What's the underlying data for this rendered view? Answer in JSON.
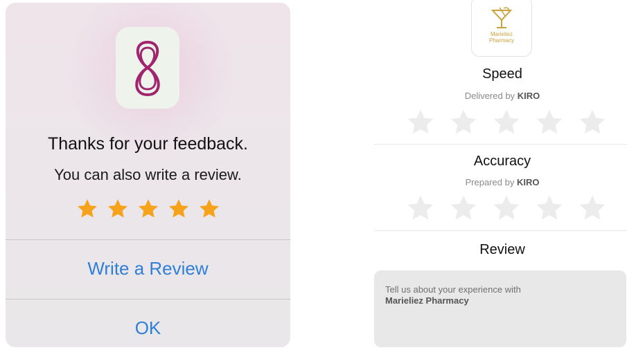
{
  "review_alert": {
    "title": "Thanks for your feedback.",
    "message": "You can also write a review.",
    "rating": 5,
    "rating_max": 5,
    "write_review_label": "Write a Review",
    "ok_label": "OK",
    "icons": {
      "app": "infinity-loop-app-icon",
      "star": "star-icon"
    },
    "colors": {
      "star": "#f6a21b",
      "button_text": "#2f7fd9",
      "app_icon_stroke": "#a0246e"
    }
  },
  "rating_panel": {
    "store_logo_text": "Marieliez Pharmacy",
    "sections": [
      {
        "title": "Speed",
        "subtitle_prefix": "Delivered by",
        "subtitle_name": "KIRO",
        "rating": 0,
        "rating_max": 5
      },
      {
        "title": "Accuracy",
        "subtitle_prefix": "Prepared by",
        "subtitle_name": "KIRO",
        "rating": 0,
        "rating_max": 5
      }
    ],
    "review": {
      "title": "Review",
      "placeholder_prefix": "Tell us about your experience with",
      "placeholder_name": "Marieliez Pharmacy"
    },
    "colors": {
      "empty_star": "#ececec",
      "logo_gold": "#c9a23c"
    }
  }
}
